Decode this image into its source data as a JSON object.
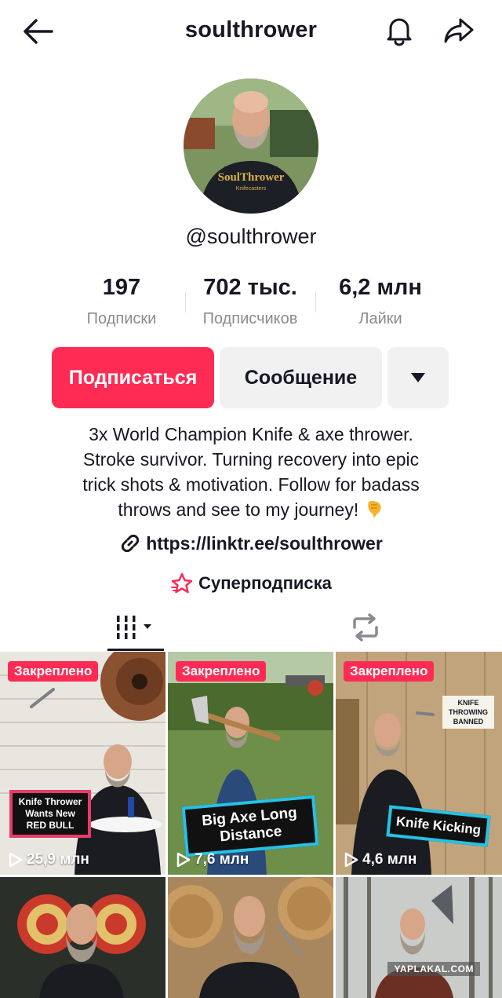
{
  "header": {
    "title": "soulthrower",
    "back_icon": "arrow-left-icon",
    "bell_icon": "bell-icon",
    "share_icon": "share-arrow-icon"
  },
  "profile": {
    "handle": "@soulthrower",
    "stats": [
      {
        "value": "197",
        "label": "Подписки"
      },
      {
        "value": "702 тыс.",
        "label": "Подписчиков"
      },
      {
        "value": "6,2 млн",
        "label": "Лайки"
      }
    ],
    "buttons": {
      "follow": "Подписаться",
      "message": "Сообщение"
    },
    "bio": {
      "line1": "3x World Champion Knife & axe thrower.",
      "line2": "Stroke survivor. Turning recovery into epic",
      "line3": "trick shots & motivation. Follow for badass",
      "line4": "throws and see to my journey!"
    },
    "link": "https://linktr.ee/soulthrower",
    "superfollow": "Суперподписка"
  },
  "colors": {
    "accent": "#fe2c55",
    "secondary_button": "#f1f1f2",
    "text": "#161823",
    "muted": "#8a8b91"
  },
  "videos": [
    {
      "pinned": "Закреплено",
      "caption": "Knife Thrower Wants New RED BULL",
      "views": "25,9 млн"
    },
    {
      "pinned": "Закреплено",
      "caption": "Big Axe Long Distance",
      "views": "7,6 млн"
    },
    {
      "pinned": "Закреплено",
      "caption": "Knife Kicking",
      "views": "4,6 млн",
      "sign": "KNIFE THROWING BANNED"
    },
    {},
    {},
    {}
  ],
  "watermark": "YAPLAKAL.COM"
}
